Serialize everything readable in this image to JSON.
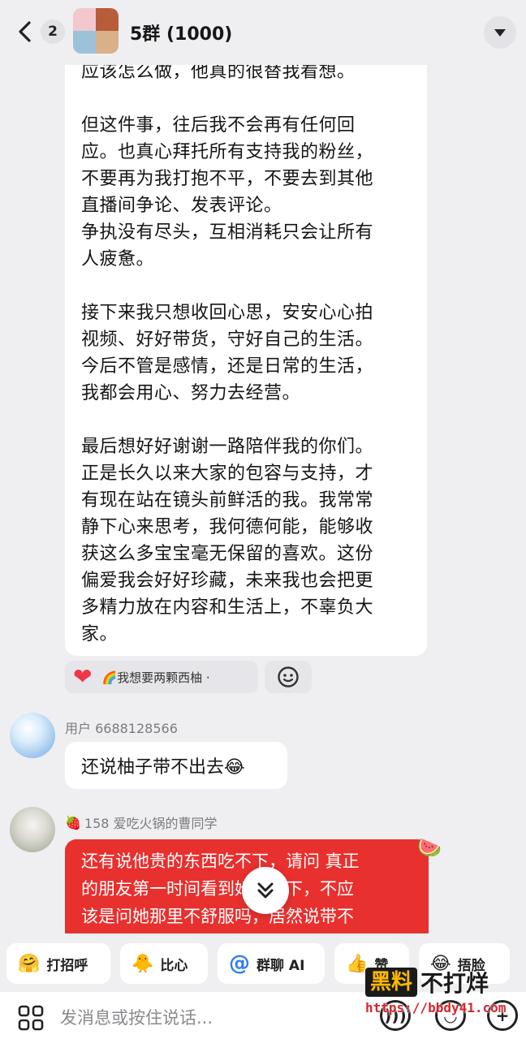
{
  "header": {
    "unread_count": "2",
    "group_name": "5群 (1000)"
  },
  "message_main": {
    "lines": [
      "应该怎么做，他真的很替我看想。",
      "但这件事，往后我不会再有任何回",
      "应。也真心拜托所有支持我的粉丝，",
      "不要再为我打抱不平，不要去到其他",
      "直播间争论、发表评论。",
      "争执没有尽头，互相消耗只会让所有",
      "人疲惫。",
      "接下来我只想收回心思，安安心心拍",
      "视频、好好带货，守好自己的生活。",
      "今后不管是感情，还是日常的生活，",
      "我都会用心、努力去经营。",
      "最后想好好谢谢一路陪伴我的你们。",
      "正是长久以来大家的包容与支持，才",
      "有现在站在镜头前鲜活的我。我常常",
      "静下心来思考，我何德何能，能够收",
      "获这么多宝宝毫无保留的喜欢。这份",
      "偏爱我会好好珍藏，未来我也会把更",
      "多精力放在内容和生活上，不辜负大",
      "家。"
    ],
    "reaction_user": "🌈我想要两颗西柚 ·"
  },
  "message_2": {
    "username": "用户 6688128566",
    "text": "还说柚子带不出去😂"
  },
  "message_3": {
    "username": "158 爱吃火锅的曹同学",
    "lines": [
      "还有说他贵的东西吃不下，请问 真正",
      "的朋友第一时间看到她吃不下，不应",
      "该是问她那里不舒服吗，居然说带不"
    ]
  },
  "quick_actions": {
    "greet": "打招呼",
    "heart": "比心",
    "ai": "群聊 AI",
    "like": "赞",
    "facepalm": "捂脸"
  },
  "input": {
    "placeholder": "发消息或按住说话..."
  },
  "watermark": {
    "left": "黑料",
    "right": "不打烊",
    "url": "https://bbdy41.com"
  }
}
